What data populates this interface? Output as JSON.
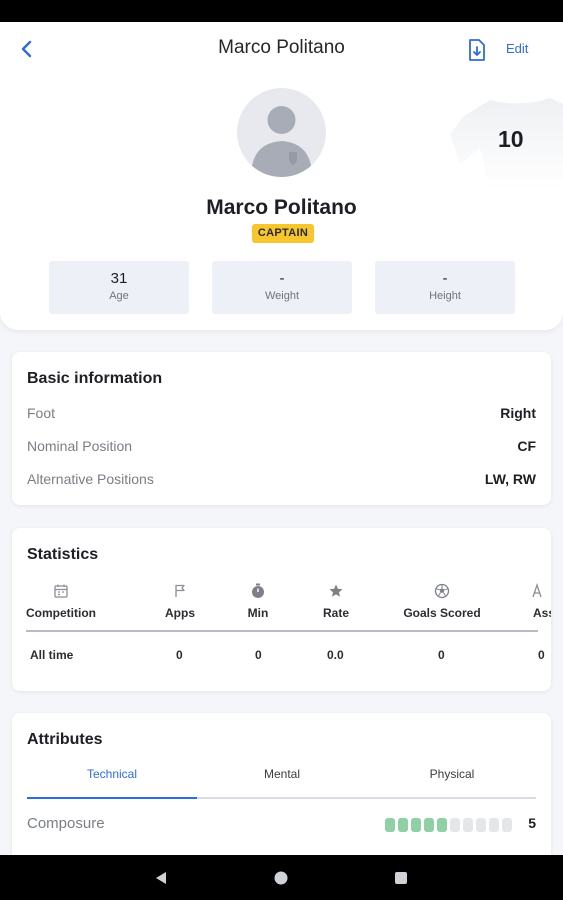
{
  "app": {
    "title": "Marco Politano",
    "edit_label": "Edit"
  },
  "colors": {
    "accent": "#2d6cdf",
    "captain_badge": "#f7c62f",
    "attribute_on": "#8fd0a4",
    "attribute_off": "#e4e6ea"
  },
  "icons": {
    "back": "arrow-left",
    "export": "file-download",
    "jersey": "jersey",
    "avatar": "person-placeholder"
  },
  "player": {
    "name": "Marco Politano",
    "badge": "CAPTAIN",
    "jersey_number": "10",
    "stats": [
      {
        "value": "31",
        "label": "Age"
      },
      {
        "value": "-",
        "label": "Weight"
      },
      {
        "value": "-",
        "label": "Height"
      }
    ]
  },
  "basic_info": {
    "title": "Basic information",
    "rows": [
      {
        "label": "Foot",
        "value": "Right"
      },
      {
        "label": "Nominal Position",
        "value": "CF"
      },
      {
        "label": "Alternative Positions",
        "value": "LW, RW"
      }
    ]
  },
  "statistics": {
    "title": "Statistics",
    "columns": [
      {
        "label": "Competition",
        "icon": "calendar-icon"
      },
      {
        "label": "Apps",
        "icon": "flag-icon"
      },
      {
        "label": "Min",
        "icon": "stopwatch-icon"
      },
      {
        "label": "Rate",
        "icon": "star-icon"
      },
      {
        "label": "Goals Scored",
        "icon": "soccer-ball-icon"
      },
      {
        "label": "Assis",
        "icon": "assist-icon"
      }
    ],
    "rows": [
      {
        "competition": "All time",
        "apps": "0",
        "min": "0",
        "rate": "0.0",
        "goals": "0",
        "assists": "0"
      }
    ]
  },
  "attributes": {
    "title": "Attributes",
    "tabs": [
      "Technical",
      "Mental",
      "Physical"
    ],
    "active_tab": "Technical",
    "items": [
      {
        "label": "Composure",
        "value": "5",
        "max": 10
      }
    ]
  },
  "system_nav": {
    "back": "back-triangle",
    "home": "home-circle",
    "recents": "recents-square"
  }
}
